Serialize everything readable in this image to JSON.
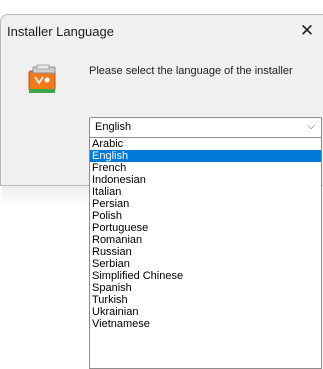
{
  "dialog": {
    "title": "Installer Language",
    "close_glyph": "✕",
    "icon": "installer-app-icon",
    "prompt": "Please select the language of the installer"
  },
  "language_select": {
    "value": "English",
    "chevron": "⌵",
    "options": [
      "Arabic",
      "English",
      "French",
      "Indonesian",
      "Italian",
      "Persian",
      "Polish",
      "Portuguese",
      "Romanian",
      "Russian",
      "Serbian",
      "Simplified Chinese",
      "Spanish",
      "Turkish",
      "Ukrainian",
      "Vietnamese"
    ],
    "selected_index": 1
  },
  "colors": {
    "dialog_bg": "#f0f0f0",
    "highlight": "#0078d7"
  }
}
